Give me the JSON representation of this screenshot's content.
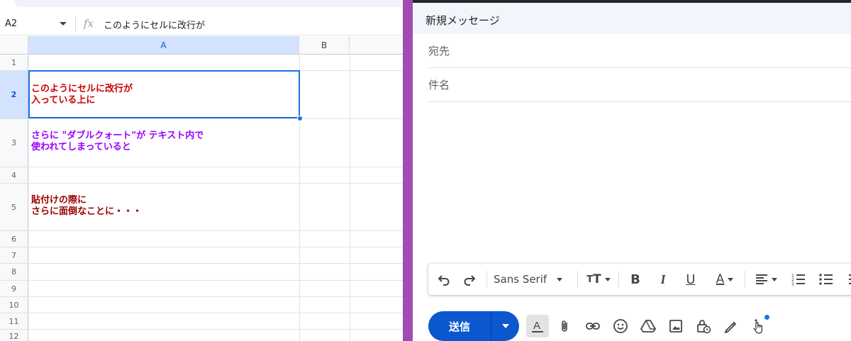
{
  "sheet": {
    "name_box": "A2",
    "formula_icon": "fx",
    "formula_value": "このようにセルに改行が",
    "columns": [
      "A",
      "B"
    ],
    "rows": [
      {
        "num": "1",
        "text": "",
        "color": "#000000"
      },
      {
        "num": "2",
        "text": "このようにセルに改行が\n入っている上に",
        "color": "#cc0000"
      },
      {
        "num": "3",
        "text": "さらに \"ダブルクォート\"が テキスト内で\n使われてしまっていると",
        "color": "#9900ff"
      },
      {
        "num": "4",
        "text": "",
        "color": "#000000"
      },
      {
        "num": "5",
        "text": "貼付けの際に\nさらに面倒なことに・・・",
        "color": "#990000"
      },
      {
        "num": "6",
        "text": "",
        "color": "#000000"
      },
      {
        "num": "7",
        "text": "",
        "color": "#000000"
      },
      {
        "num": "8",
        "text": "",
        "color": "#000000"
      },
      {
        "num": "9",
        "text": "",
        "color": "#000000"
      },
      {
        "num": "10",
        "text": "",
        "color": "#000000"
      },
      {
        "num": "11",
        "text": "",
        "color": "#000000"
      },
      {
        "num": "12",
        "text": "",
        "color": "#000000"
      }
    ],
    "selected_cell": "A2",
    "accent": "#1a73e8"
  },
  "compose": {
    "title": "新規メッセージ",
    "to_placeholder": "宛先",
    "subject_placeholder": "件名",
    "format_bar": {
      "undo_icon": "undo-icon",
      "redo_icon": "redo-icon",
      "font": "Sans Serif",
      "size_icon": "text-size-icon",
      "bold": "B",
      "italic": "I",
      "underline": "U",
      "text_color": "A",
      "align_icon": "align-icon",
      "numbered_icon": "numbered-list-icon",
      "bulleted_icon": "bulleted-list-icon"
    },
    "send_label": "送信",
    "send_color": "#0b57d0",
    "bottom_icons": [
      "formatting-icon",
      "attach-icon",
      "link-icon",
      "emoji-icon",
      "drive-icon",
      "photo-icon",
      "confidential-icon",
      "signature-icon",
      "more-options-icon"
    ]
  },
  "divider_color": "#a24bb1"
}
